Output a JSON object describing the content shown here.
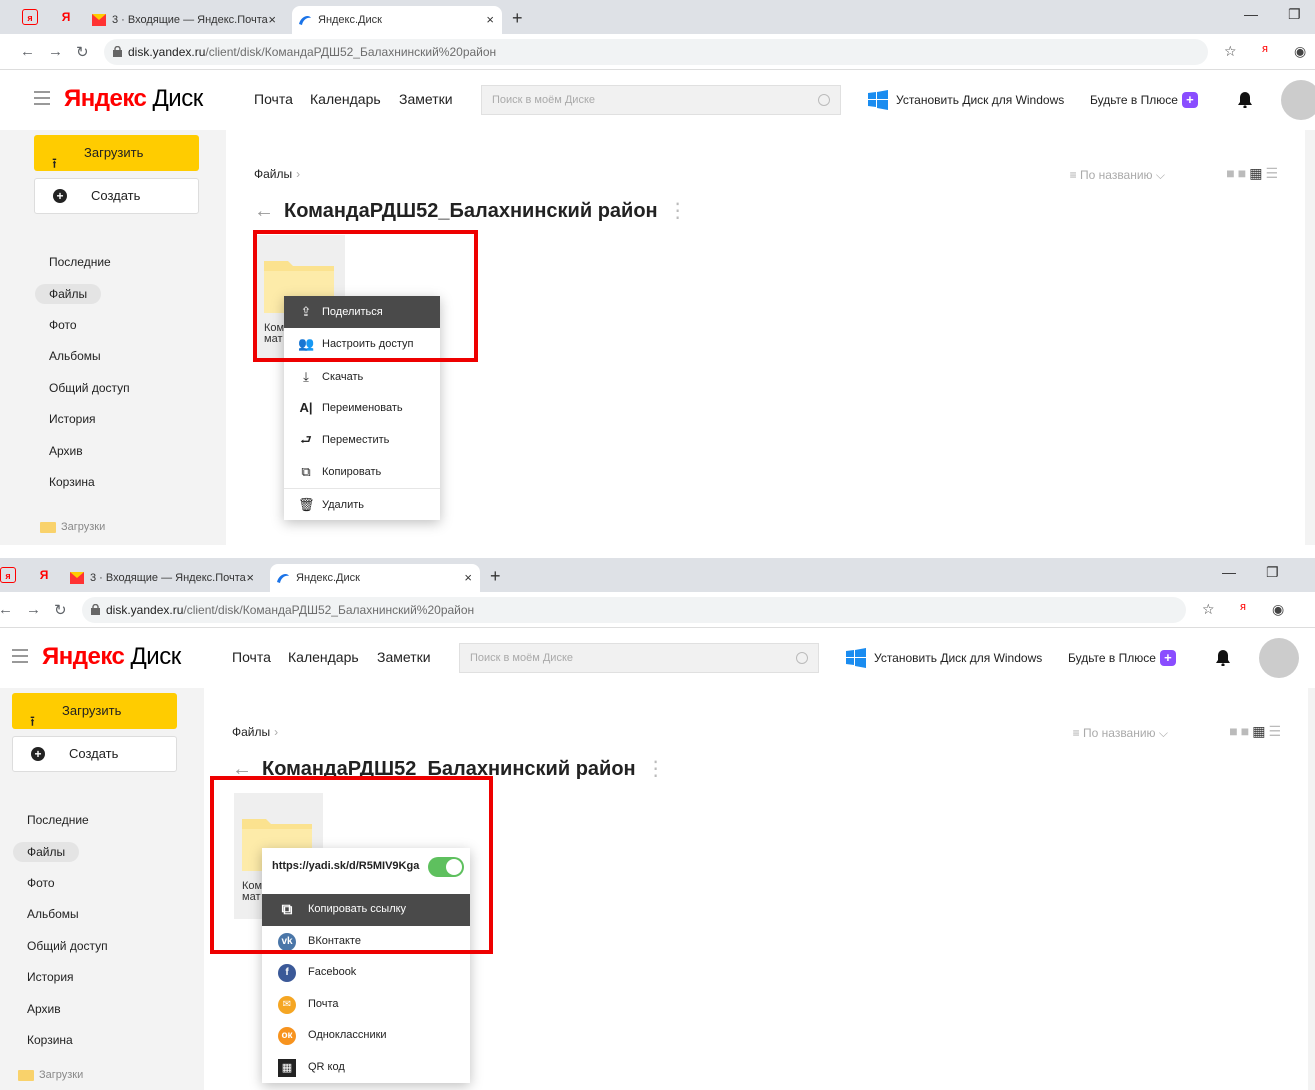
{
  "browser": {
    "tabs": [
      {
        "label": "3 · Входящие — Яндекс.Почта"
      },
      {
        "label": "Яндекс.Диск"
      }
    ],
    "close_glyph": "×",
    "newtab_glyph": "+",
    "url_host": "disk.yandex.ru",
    "url_path": "/client/disk/КомандаРДШ52_Балахнинский%20район",
    "ya_glyph": "я",
    "pinned_glyph": "Я"
  },
  "header": {
    "logo_brand": "Яндекс",
    "logo_product": "Диск",
    "nav": [
      "Почта",
      "Календарь",
      "Заметки"
    ],
    "search_placeholder": "Поиск в моём Диске",
    "install_label": "Установить Диск для Windows",
    "plus_label": "Будьте в Плюсе"
  },
  "sidebar": {
    "upload_label": "Загрузить",
    "create_label": "Создать",
    "items": [
      "Последние",
      "Файлы",
      "Фото",
      "Альбомы",
      "Общий доступ",
      "История",
      "Архив",
      "Корзина"
    ],
    "active_item": "Файлы",
    "folder_label": "Загрузки"
  },
  "main": {
    "breadcrumb": "Файлы",
    "breadcrumb_arrow": "›",
    "sort_label": "По названию",
    "title": "КомандаРДШ52_Балахнинский район",
    "folder_name_line1": "Ком",
    "folder_name_line2": "мат"
  },
  "context_menu": {
    "items": [
      "Поделиться",
      "Настроить доступ",
      "Скачать",
      "Переименовать",
      "Переместить",
      "Копировать",
      "Удалить"
    ],
    "highlighted": "Поделиться"
  },
  "share_menu": {
    "link": "https://yadi.sk/d/R5MIV9Kga",
    "toggle_on": true,
    "items": [
      "Копировать ссылку",
      "ВКонтакте",
      "Facebook",
      "Почта",
      "Одноклассники",
      "QR код"
    ],
    "highlighted": "Копировать ссылку"
  },
  "colors": {
    "accent_yellow": "#ffcc00",
    "highlight_red": "#e00000",
    "toggle_green": "#5ec05e",
    "yandex_red": "#ff0000"
  },
  "icons": {
    "share": "share-icon",
    "access": "people-icon",
    "download": "download-icon",
    "rename": "rename-icon",
    "move": "move-icon",
    "copy": "copy-icon",
    "delete": "trash-icon",
    "vk": "vk-icon",
    "facebook": "facebook-icon",
    "mail": "mail-icon",
    "ok": "odnoklassniki-icon",
    "qr": "qr-icon"
  }
}
